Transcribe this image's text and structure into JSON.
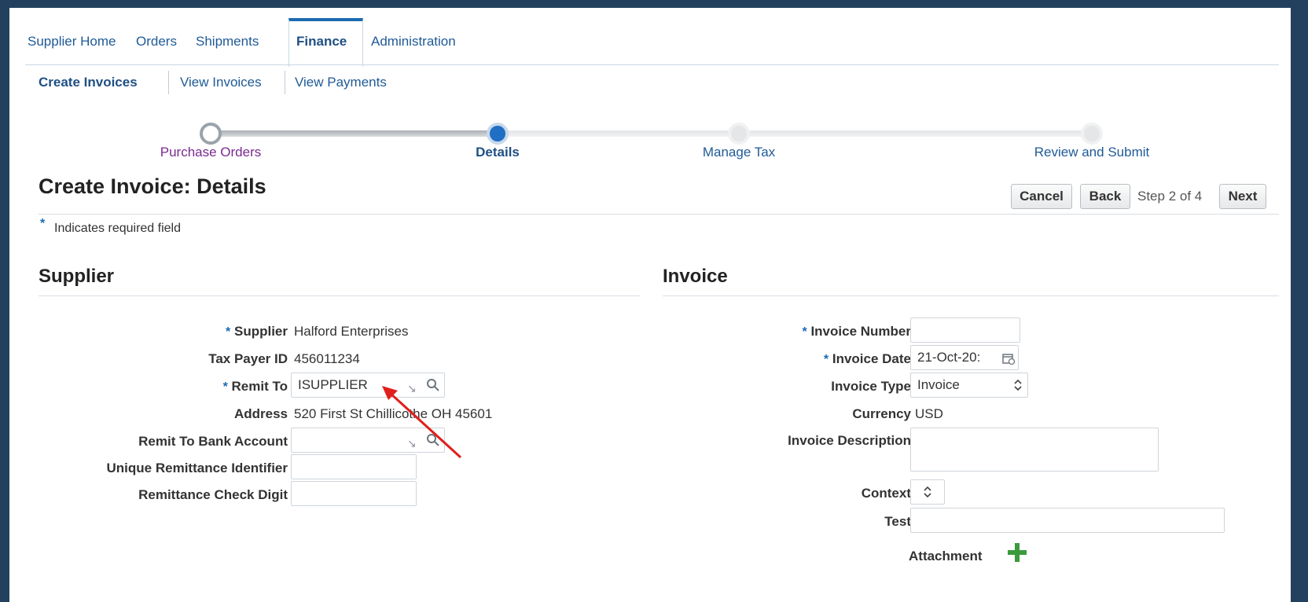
{
  "tabs": {
    "supplier_home": "Supplier Home",
    "orders": "Orders",
    "shipments": "Shipments",
    "finance": "Finance",
    "administration": "Administration"
  },
  "subtabs": {
    "create_invoices": "Create Invoices",
    "view_invoices": "View Invoices",
    "view_payments": "View Payments"
  },
  "train": {
    "steps": [
      "Purchase Orders",
      "Details",
      "Manage Tax",
      "Review and Submit"
    ],
    "colors": {
      "visited": "#7a2a8f",
      "current": "#1f4f84",
      "next": "#1f5a96"
    }
  },
  "page": {
    "title": "Create Invoice: Details",
    "required_note": "Indicates required field",
    "required_star": "*",
    "step_text": "Step 2 of 4"
  },
  "buttons": {
    "cancel": "Cancel",
    "back": "Back",
    "next": "Next"
  },
  "supplier": {
    "heading": "Supplier",
    "supplier_label": "Supplier",
    "supplier_value": "Halford Enterprises",
    "taxpayer_label": "Tax Payer ID",
    "taxpayer_value": "456011234",
    "remit_label": "Remit To",
    "remit_value": "ISUPPLIER",
    "address_label": "Address",
    "address_value": "520 First St Chillicothe OH 45601",
    "bank_label": "Remit To Bank Account",
    "bank_value": "",
    "uri_label": "Unique Remittance Identifier",
    "uri_value": "",
    "check_label": "Remittance Check Digit",
    "check_value": ""
  },
  "invoice": {
    "heading": "Invoice",
    "number_label": "Invoice Number",
    "number_value": "",
    "date_label": "Invoice Date",
    "date_value": "21-Oct-20:",
    "type_label": "Invoice Type",
    "type_value": "Invoice",
    "currency_label": "Currency",
    "currency_value": "USD",
    "description_label": "Invoice Description",
    "description_value": "",
    "context_label": "Context",
    "context_value": "",
    "test_label": "Test",
    "test_value": "",
    "attachment_label": "Attachment"
  },
  "icons": {
    "search": "search-icon",
    "lov": "lov-arrow-icon",
    "calendar": "calendar-icon",
    "select": "select-arrows-icon",
    "add": "add-icon",
    "annotation": "red-arrow"
  },
  "colors": {
    "link": "#1f5a96",
    "accent": "#1c6bb3",
    "add_icon": "#3c9a3c",
    "annotation": "#e0201c"
  }
}
